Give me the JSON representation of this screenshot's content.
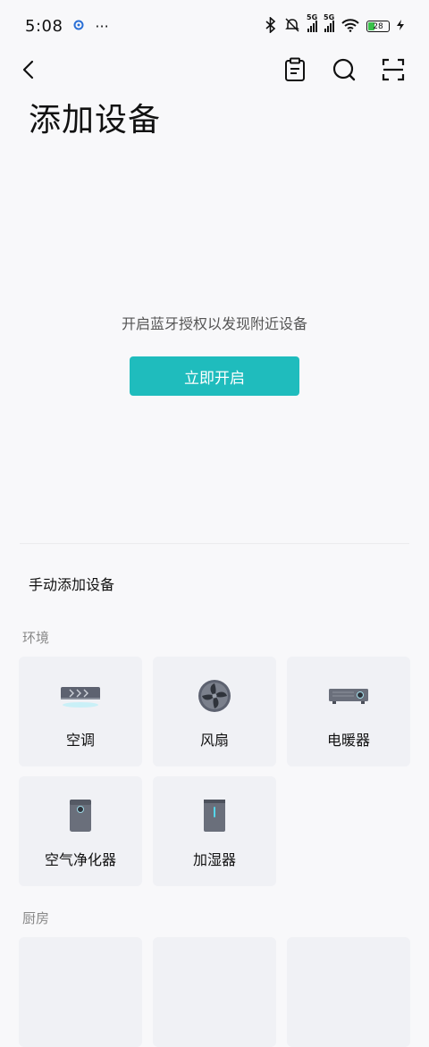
{
  "status_bar": {
    "time": "5:08",
    "dots": "···",
    "network_1": "5G",
    "network_2": "5G",
    "battery": "28"
  },
  "header": {
    "title": "添加设备"
  },
  "bluetooth": {
    "message": "开启蓝牙授权以发现附近设备",
    "button_label": "立即开启",
    "button_color": "#1fbcbd"
  },
  "manual": {
    "title": "手动添加设备",
    "sections": [
      {
        "label": "环境",
        "devices": [
          {
            "label": "空调",
            "icon": "air-conditioner-icon"
          },
          {
            "label": "风扇",
            "icon": "fan-icon"
          },
          {
            "label": "电暖器",
            "icon": "electric-heater-icon"
          },
          {
            "label": "空气净化器",
            "icon": "air-purifier-icon"
          },
          {
            "label": "加湿器",
            "icon": "humidifier-icon"
          }
        ]
      },
      {
        "label": "厨房",
        "devices": []
      }
    ]
  }
}
